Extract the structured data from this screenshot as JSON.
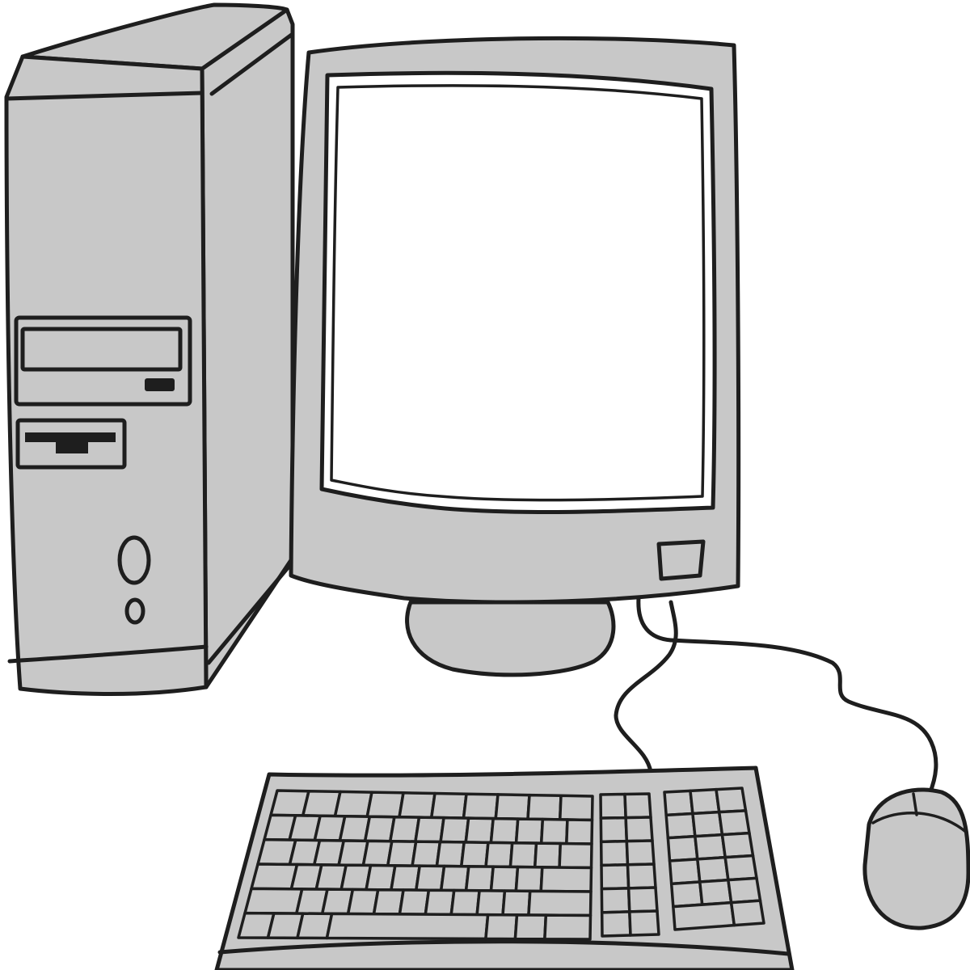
{
  "colors": {
    "ink": "#1e1e1e",
    "gray": "#c8c8c8",
    "screen": "#ffffff",
    "background": "#ffffff"
  },
  "illustration": {
    "parts": [
      "tower-case",
      "monitor",
      "keyboard",
      "mouse"
    ],
    "tower": {
      "drives": [
        "optical-drive",
        "floppy-drive"
      ],
      "buttons": [
        "power-button",
        "reset-button"
      ]
    },
    "monitor": {
      "screen_state": "blank",
      "buttons": [
        "monitor-power-button"
      ]
    },
    "keyboard": {
      "main_rows": 6,
      "nav_block_rows": 6,
      "numpad_rows": 6
    }
  }
}
